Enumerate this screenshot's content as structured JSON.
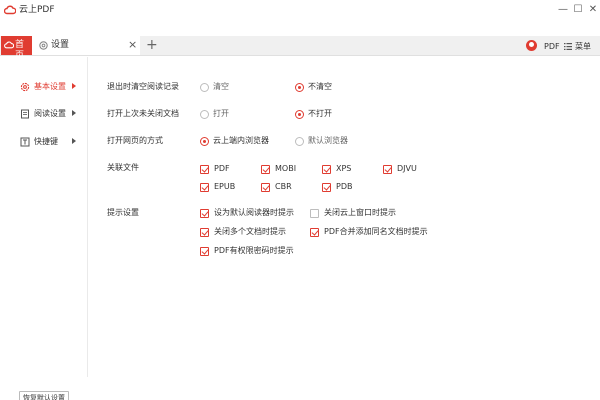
{
  "window": {
    "title": "云上PDF",
    "minimize_glyph": "—",
    "maximize_glyph": "☐",
    "close_glyph": "✕"
  },
  "tabs": {
    "home_label": "首页",
    "settings_label": "设置",
    "close_glyph": "×",
    "add_glyph": "+"
  },
  "header_right": {
    "pdf_label": "PDF",
    "menu_label": "菜单"
  },
  "sidebar": {
    "items": [
      {
        "label": "基本设置",
        "icon": "gear-icon",
        "active": true
      },
      {
        "label": "阅读设置",
        "icon": "book-icon",
        "active": false
      },
      {
        "label": "快捷键",
        "icon": "keyboard-t-icon",
        "active": false
      }
    ],
    "restore_label": "恢复默认设置"
  },
  "settings": {
    "clear_history": {
      "label": "退出时清空阅读记录",
      "options": [
        "清空",
        "不清空"
      ],
      "selected": "不清空"
    },
    "reopen_docs": {
      "label": "打开上次未关闭文档",
      "options": [
        "打开",
        "不打开"
      ],
      "selected": "不打开"
    },
    "open_web": {
      "label": "打开网页的方式",
      "options": [
        "云上端内浏览器",
        "默认浏览器"
      ],
      "selected": "云上端内浏览器"
    },
    "file_assoc": {
      "label": "关联文件",
      "types": [
        {
          "name": "PDF",
          "checked": true
        },
        {
          "name": "MOBI",
          "checked": true
        },
        {
          "name": "XPS",
          "checked": true
        },
        {
          "name": "DJVU",
          "checked": true
        },
        {
          "name": "EPUB",
          "checked": true
        },
        {
          "name": "CBR",
          "checked": true
        },
        {
          "name": "PDB",
          "checked": true
        }
      ]
    },
    "prompts": {
      "label": "提示设置",
      "items": [
        {
          "text": "设为默认阅读器时提示",
          "checked": true
        },
        {
          "text": "关闭云上窗口时提示",
          "checked": false
        },
        {
          "text": "关闭多个文档时提示",
          "checked": true
        },
        {
          "text": "PDF合并添加同名文档时提示",
          "checked": true
        },
        {
          "text": "PDF有权限密码时提示",
          "checked": true
        }
      ]
    }
  },
  "colors": {
    "accent": "#e03c31",
    "tabbar_bg": "#f0f0f0"
  }
}
